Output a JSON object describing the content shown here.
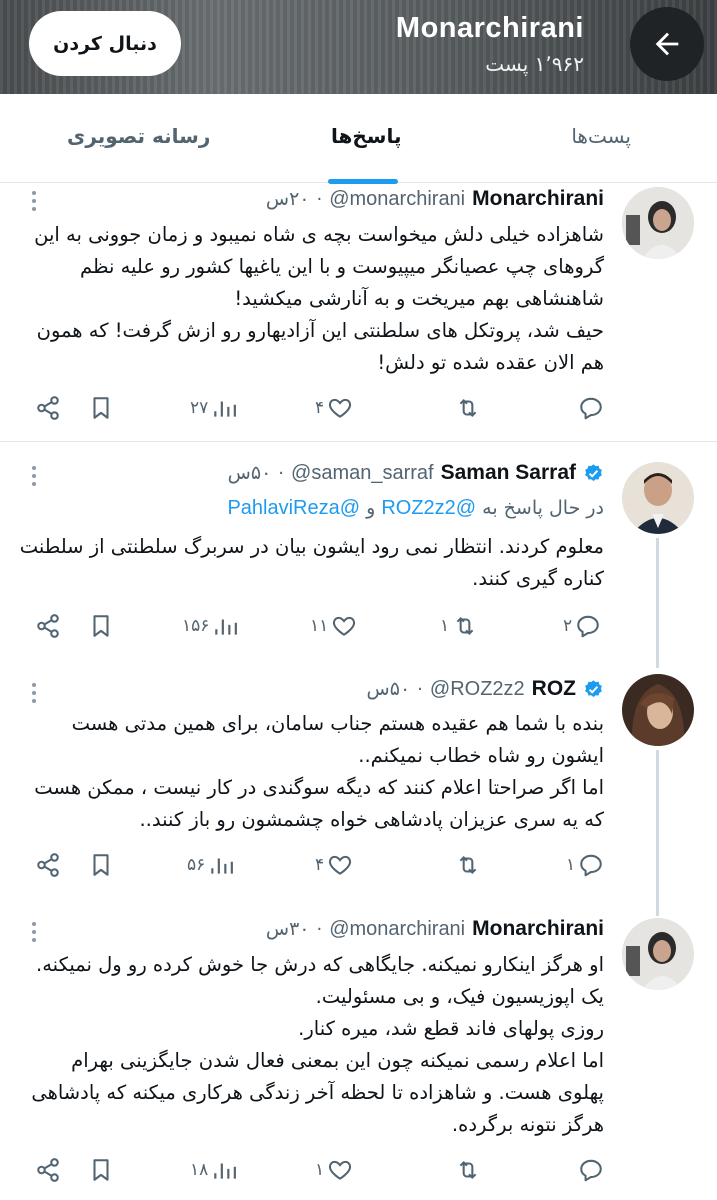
{
  "header": {
    "title": "Monarchirani",
    "post_count": "۱٬۹۶۲ پست",
    "follow_label": "دنبال کردن",
    "bg_color": "#5a5f62"
  },
  "tabs": {
    "posts": "پست‌ها",
    "replies": "پاسخ‌ها",
    "media": "رسانه تصویری",
    "active": "replies",
    "indicator_color": "#1d9bf0"
  },
  "tweets": [
    {
      "display_name": "Monarchirani",
      "handle": "@monarchirani",
      "separator": "·",
      "time": "۲۰س",
      "verified": false,
      "body": "شاهزاده خیلی دلش میخواست بچه ی شاه نمیبود و زمان جوونی به این\nگروهای چپ عصیانگر میپیوست و با این یاغیها کشور رو علیه نظم\nشاهنشاهی بهم میریخت و به آنارشی میکشید!\nحیف شد، پروتکل های سلطنتی این آزادیهارو رو ازش گرفت! که همون\nهم الان عقده شده تو دلش!",
      "replies": "",
      "retweets": "",
      "likes": "۴",
      "views": "۲۷"
    },
    {
      "display_name": "Saman Sarraf",
      "handle": "@saman_sarraf",
      "separator": "·",
      "time": "۵۰س",
      "verified": true,
      "reply_prefix": "در حال پاسخ به",
      "reply_mention_1": "@ROZ2z2",
      "reply_and": "و",
      "reply_mention_2": "@PahlaviReza",
      "body": "معلوم کردند. انتظار نمی رود ایشون بیان در سربرگ سلطنتی از سلطنت\nکناره گیری کنند.",
      "replies": "۲",
      "retweets": "۱",
      "likes": "۱۱",
      "views": "۱۵۶"
    },
    {
      "display_name": "ROZ",
      "handle": "@ROZ2z2",
      "separator": "·",
      "time": "۵۰س",
      "verified": true,
      "body": "بنده با شما هم عقیده هستم جناب سامان، برای همین مدتی هست\nایشون رو شاه خطاب نمیکنم..\nاما اگر صراحتا اعلام کنند که دیگه سوگندی در کار نیست ، ممکن هست\nکه یه سری عزیزان پادشاهی خواه چشمشون رو باز کنند..",
      "replies": "۱",
      "retweets": "",
      "likes": "۴",
      "views": "۵۶"
    },
    {
      "display_name": "Monarchirani",
      "handle": "@monarchirani",
      "separator": "·",
      "time": "۳۰س",
      "verified": false,
      "body": "او هرگز اینکارو نمیکنه. جایگاهی که درش جا خوش کرده رو ول نمیکنه.\nیک اپوزیسیون فیک، و بی مسئولیت.\nروزی پولهای فاند قطع شد، میره کنار.\nاما اعلام رسمی نمیکنه چون این بمعنی فعال شدن جایگزینی بهرام\nپهلوی هست. و شاهزاده تا لحظه آخر زندگی هرکاری میکنه که پادشاهی\nهرگز نتونه برگرده.",
      "replies": "",
      "retweets": "",
      "likes": "۱",
      "views": "۱۸"
    }
  ],
  "colors": {
    "text": "#0f1419",
    "secondary": "#536471",
    "accent": "#1d9bf0",
    "thread_line": "#cfd9de"
  },
  "icons": [
    "back-arrow-icon",
    "more-icon",
    "verified-badge-icon",
    "reply-icon",
    "retweet-icon",
    "like-icon",
    "views-icon",
    "bookmark-icon",
    "share-icon"
  ]
}
